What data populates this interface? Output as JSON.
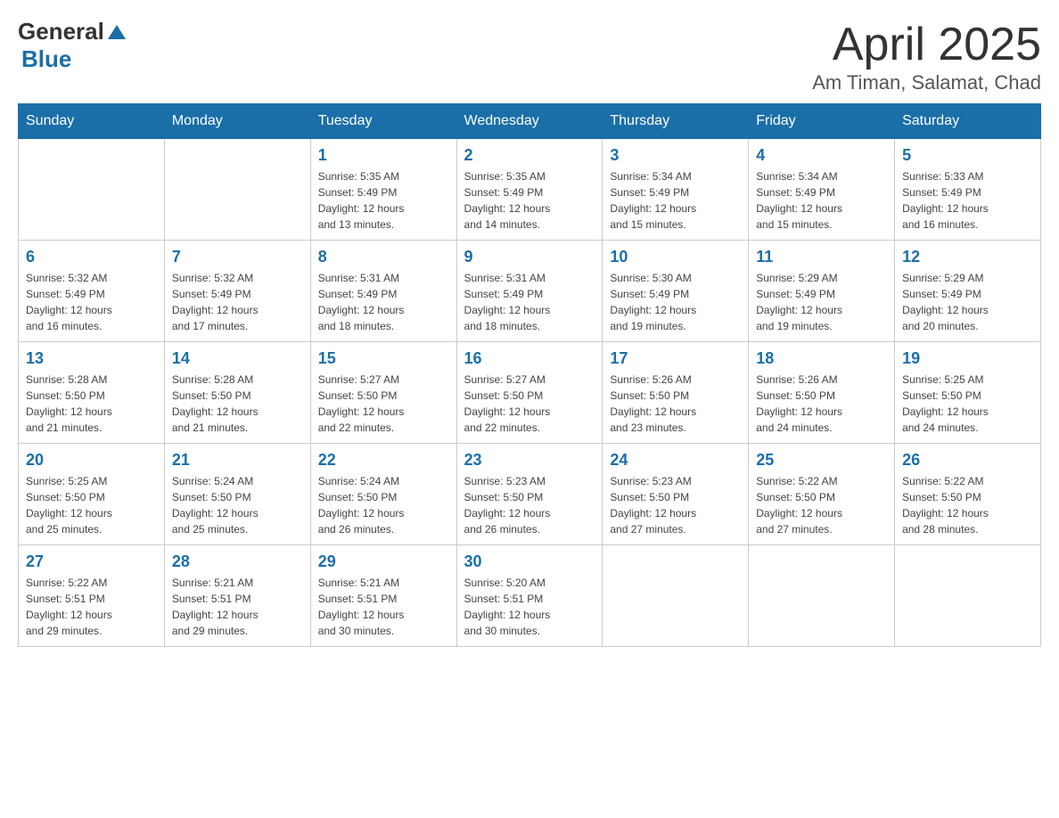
{
  "logo": {
    "general": "General",
    "blue": "Blue",
    "arrow": "▲"
  },
  "title": "April 2025",
  "location": "Am Timan, Salamat, Chad",
  "days_of_week": [
    "Sunday",
    "Monday",
    "Tuesday",
    "Wednesday",
    "Thursday",
    "Friday",
    "Saturday"
  ],
  "weeks": [
    [
      {
        "day": "",
        "info": ""
      },
      {
        "day": "",
        "info": ""
      },
      {
        "day": "1",
        "info": "Sunrise: 5:35 AM\nSunset: 5:49 PM\nDaylight: 12 hours\nand 13 minutes."
      },
      {
        "day": "2",
        "info": "Sunrise: 5:35 AM\nSunset: 5:49 PM\nDaylight: 12 hours\nand 14 minutes."
      },
      {
        "day": "3",
        "info": "Sunrise: 5:34 AM\nSunset: 5:49 PM\nDaylight: 12 hours\nand 15 minutes."
      },
      {
        "day": "4",
        "info": "Sunrise: 5:34 AM\nSunset: 5:49 PM\nDaylight: 12 hours\nand 15 minutes."
      },
      {
        "day": "5",
        "info": "Sunrise: 5:33 AM\nSunset: 5:49 PM\nDaylight: 12 hours\nand 16 minutes."
      }
    ],
    [
      {
        "day": "6",
        "info": "Sunrise: 5:32 AM\nSunset: 5:49 PM\nDaylight: 12 hours\nand 16 minutes."
      },
      {
        "day": "7",
        "info": "Sunrise: 5:32 AM\nSunset: 5:49 PM\nDaylight: 12 hours\nand 17 minutes."
      },
      {
        "day": "8",
        "info": "Sunrise: 5:31 AM\nSunset: 5:49 PM\nDaylight: 12 hours\nand 18 minutes."
      },
      {
        "day": "9",
        "info": "Sunrise: 5:31 AM\nSunset: 5:49 PM\nDaylight: 12 hours\nand 18 minutes."
      },
      {
        "day": "10",
        "info": "Sunrise: 5:30 AM\nSunset: 5:49 PM\nDaylight: 12 hours\nand 19 minutes."
      },
      {
        "day": "11",
        "info": "Sunrise: 5:29 AM\nSunset: 5:49 PM\nDaylight: 12 hours\nand 19 minutes."
      },
      {
        "day": "12",
        "info": "Sunrise: 5:29 AM\nSunset: 5:49 PM\nDaylight: 12 hours\nand 20 minutes."
      }
    ],
    [
      {
        "day": "13",
        "info": "Sunrise: 5:28 AM\nSunset: 5:50 PM\nDaylight: 12 hours\nand 21 minutes."
      },
      {
        "day": "14",
        "info": "Sunrise: 5:28 AM\nSunset: 5:50 PM\nDaylight: 12 hours\nand 21 minutes."
      },
      {
        "day": "15",
        "info": "Sunrise: 5:27 AM\nSunset: 5:50 PM\nDaylight: 12 hours\nand 22 minutes."
      },
      {
        "day": "16",
        "info": "Sunrise: 5:27 AM\nSunset: 5:50 PM\nDaylight: 12 hours\nand 22 minutes."
      },
      {
        "day": "17",
        "info": "Sunrise: 5:26 AM\nSunset: 5:50 PM\nDaylight: 12 hours\nand 23 minutes."
      },
      {
        "day": "18",
        "info": "Sunrise: 5:26 AM\nSunset: 5:50 PM\nDaylight: 12 hours\nand 24 minutes."
      },
      {
        "day": "19",
        "info": "Sunrise: 5:25 AM\nSunset: 5:50 PM\nDaylight: 12 hours\nand 24 minutes."
      }
    ],
    [
      {
        "day": "20",
        "info": "Sunrise: 5:25 AM\nSunset: 5:50 PM\nDaylight: 12 hours\nand 25 minutes."
      },
      {
        "day": "21",
        "info": "Sunrise: 5:24 AM\nSunset: 5:50 PM\nDaylight: 12 hours\nand 25 minutes."
      },
      {
        "day": "22",
        "info": "Sunrise: 5:24 AM\nSunset: 5:50 PM\nDaylight: 12 hours\nand 26 minutes."
      },
      {
        "day": "23",
        "info": "Sunrise: 5:23 AM\nSunset: 5:50 PM\nDaylight: 12 hours\nand 26 minutes."
      },
      {
        "day": "24",
        "info": "Sunrise: 5:23 AM\nSunset: 5:50 PM\nDaylight: 12 hours\nand 27 minutes."
      },
      {
        "day": "25",
        "info": "Sunrise: 5:22 AM\nSunset: 5:50 PM\nDaylight: 12 hours\nand 27 minutes."
      },
      {
        "day": "26",
        "info": "Sunrise: 5:22 AM\nSunset: 5:50 PM\nDaylight: 12 hours\nand 28 minutes."
      }
    ],
    [
      {
        "day": "27",
        "info": "Sunrise: 5:22 AM\nSunset: 5:51 PM\nDaylight: 12 hours\nand 29 minutes."
      },
      {
        "day": "28",
        "info": "Sunrise: 5:21 AM\nSunset: 5:51 PM\nDaylight: 12 hours\nand 29 minutes."
      },
      {
        "day": "29",
        "info": "Sunrise: 5:21 AM\nSunset: 5:51 PM\nDaylight: 12 hours\nand 30 minutes."
      },
      {
        "day": "30",
        "info": "Sunrise: 5:20 AM\nSunset: 5:51 PM\nDaylight: 12 hours\nand 30 minutes."
      },
      {
        "day": "",
        "info": ""
      },
      {
        "day": "",
        "info": ""
      },
      {
        "day": "",
        "info": ""
      }
    ]
  ]
}
